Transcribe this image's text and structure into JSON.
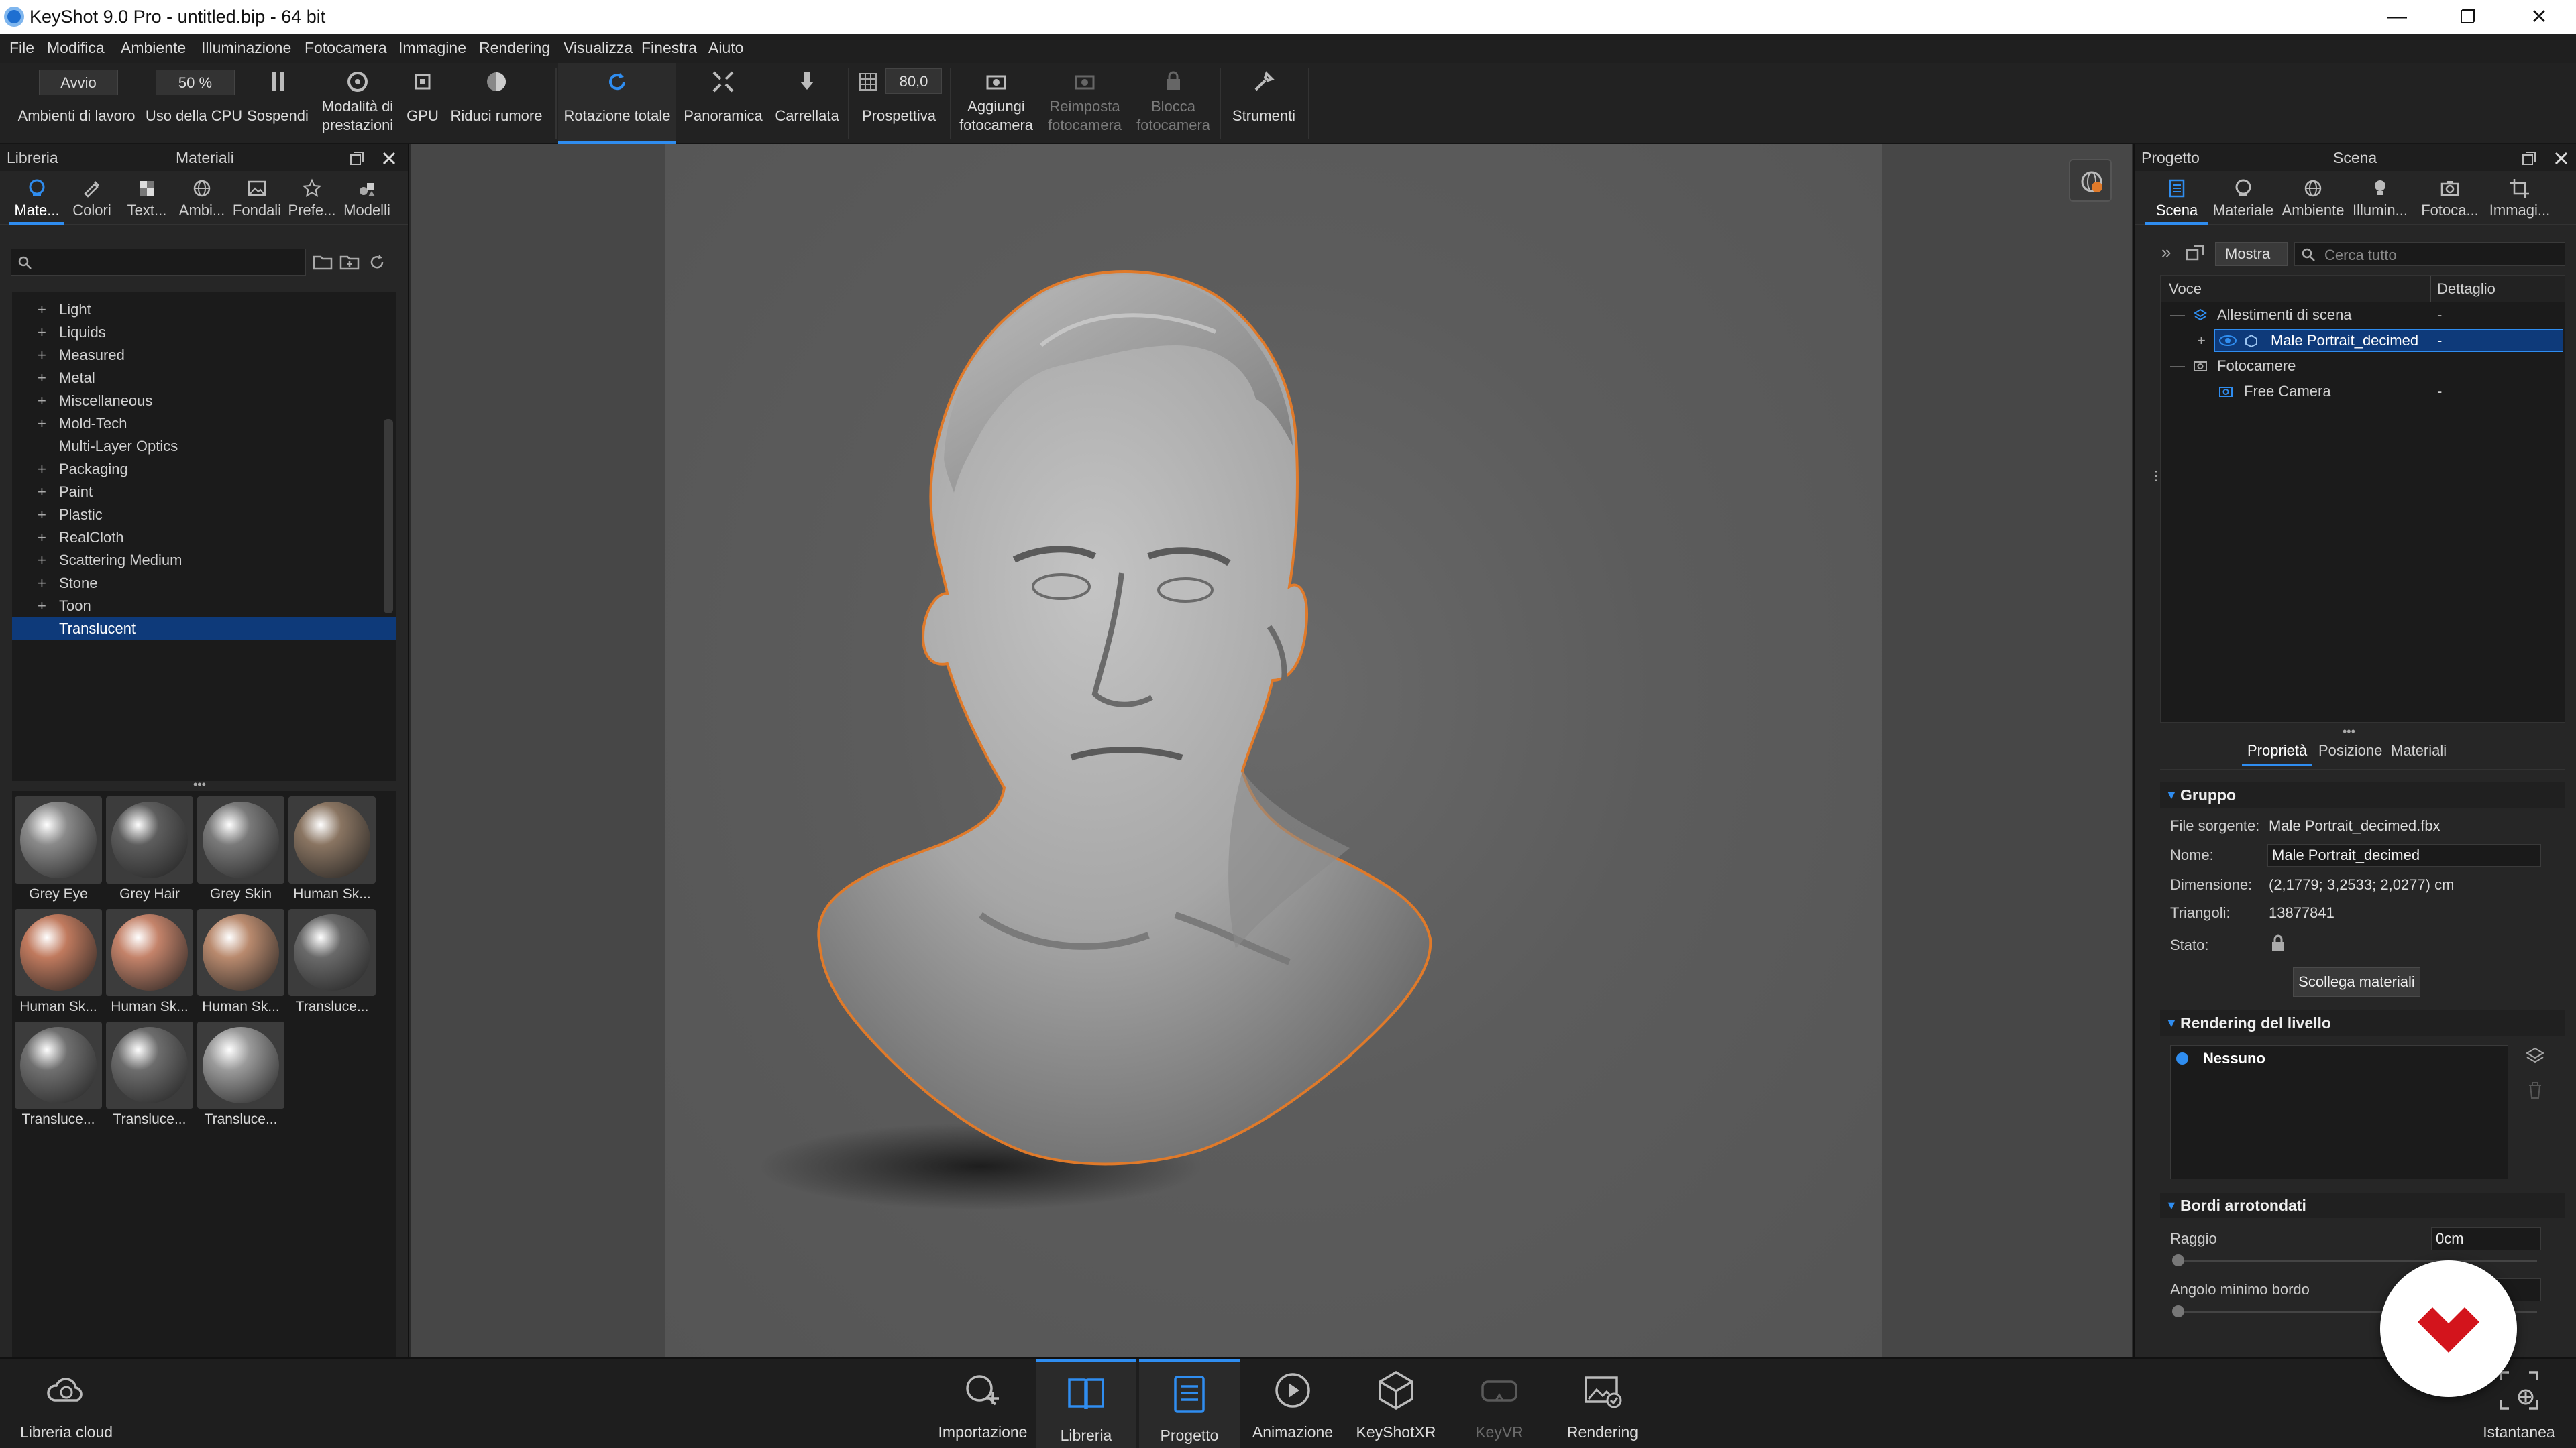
{
  "window": {
    "title": "KeyShot 9.0 Pro  - untitled.bip  - 64 bit",
    "minimize": "—",
    "maximize": "❐",
    "close": "✕"
  },
  "menu": [
    "File",
    "Modifica",
    "Ambiente",
    "Illuminazione",
    "Fotocamera",
    "Immagine",
    "Rendering",
    "Visualizza",
    "Finestra",
    "Aiuto"
  ],
  "toolbar": {
    "workspace_select": "Avvio",
    "workspace_label": "Ambienti di lavoro",
    "cpu_select": "50 %",
    "cpu_label": "Uso della CPU",
    "pause": "Sospendi",
    "perf_mode_1": "Modalità di",
    "perf_mode_2": "prestazioni",
    "gpu": "GPU",
    "denoise": "Riduci rumore",
    "tumble": "Rotazione totale",
    "pan": "Panoramica",
    "dolly": "Carrellata",
    "perspective_value": "80,0",
    "perspective": "Prospettiva",
    "add_camera_1": "Aggiungi",
    "add_camera_2": "fotocamera",
    "reset_camera_1": "Reimposta",
    "reset_camera_2": "fotocamera",
    "lock_camera_1": "Blocca",
    "lock_camera_2": "fotocamera",
    "tools": "Strumenti"
  },
  "left_panel": {
    "title_left": "Libreria",
    "title_center": "Materiali",
    "tabs": [
      "Mate...",
      "Colori",
      "Text...",
      "Ambi...",
      "Fondali",
      "Prefe...",
      "Modelli"
    ],
    "tree": [
      {
        "label": "Light",
        "plus": true
      },
      {
        "label": "Liquids",
        "plus": true
      },
      {
        "label": "Measured",
        "plus": true
      },
      {
        "label": "Metal",
        "plus": true
      },
      {
        "label": "Miscellaneous",
        "plus": true
      },
      {
        "label": "Mold-Tech",
        "plus": true
      },
      {
        "label": "Multi-Layer Optics",
        "plus": false
      },
      {
        "label": "Packaging",
        "plus": true
      },
      {
        "label": "Paint",
        "plus": true
      },
      {
        "label": "Plastic",
        "plus": true
      },
      {
        "label": "RealCloth",
        "plus": true
      },
      {
        "label": "Scattering Medium",
        "plus": true
      },
      {
        "label": "Stone",
        "plus": true
      },
      {
        "label": "Toon",
        "plus": true
      },
      {
        "label": "Translucent",
        "plus": false,
        "selected": true
      }
    ],
    "thumbnails": [
      {
        "label": "Grey Eye",
        "color": "#8a8a8a"
      },
      {
        "label": "Grey Hair",
        "color": "#5e5e5e"
      },
      {
        "label": "Grey Skin",
        "color": "#7a7a7a"
      },
      {
        "label": "Human Sk...",
        "color": "#8a7562"
      },
      {
        "label": "Human Sk...",
        "color": "#c07a5e"
      },
      {
        "label": "Human Sk...",
        "color": "#c4836a"
      },
      {
        "label": "Human Sk...",
        "color": "#b98a6e"
      },
      {
        "label": "Transluce...",
        "color": "#6a6a6a"
      },
      {
        "label": "Transluce...",
        "color": "#707070"
      },
      {
        "label": "Transluce...",
        "color": "#6d6d6d"
      },
      {
        "label": "Transluce...",
        "color": "#9a9a9a"
      }
    ]
  },
  "right_panel": {
    "title_left": "Progetto",
    "title_center": "Scena",
    "tabs": [
      "Scena",
      "Materiale",
      "Ambiente",
      "Illumin...",
      "Fotoca...",
      "Immagi..."
    ],
    "show_button": "Mostra",
    "search_placeholder": "Cerca tutto",
    "col_item": "Voce",
    "col_detail": "Dettaglio",
    "tree": {
      "sets": "Allestimenti di scena",
      "model": "Male Portrait_decimed",
      "cameras": "Fotocamere",
      "free_camera": "Free Camera",
      "dash": "-"
    },
    "bottom_tabs": [
      "Proprietà",
      "Posizione",
      "Materiali"
    ],
    "group_header": "Gruppo",
    "source_label": "File sorgente:",
    "source_value": "Male Portrait_decimed.fbx",
    "name_label": "Nome:",
    "name_value": "Male Portrait_decimed",
    "dim_label": "Dimensione:",
    "dim_value": "(2,1779; 3,2533; 2,0277) cm",
    "tri_label": "Triangoli:",
    "tri_value": "13877841",
    "state_label": "Stato:",
    "unlink_button": "Scollega materiali",
    "render_layer_header": "Rendering del livello",
    "layer_none": "Nessuno",
    "rounded_header": "Bordi arrotondati",
    "radius_label": "Raggio",
    "radius_value": "0cm",
    "min_angle_label": "Angolo minimo bordo"
  },
  "bottom_bar": {
    "cloud": "Libreria cloud",
    "buttons": [
      "Importazione",
      "Libreria",
      "Progetto",
      "Animazione",
      "KeyShotXR",
      "KeyVR",
      "Rendering"
    ],
    "snapshot": "Istantanea"
  },
  "colors": {
    "accent": "#2f8df0",
    "selection": "#0e3a7a",
    "outline": "#e07a2a",
    "logo": "#d3141c"
  }
}
